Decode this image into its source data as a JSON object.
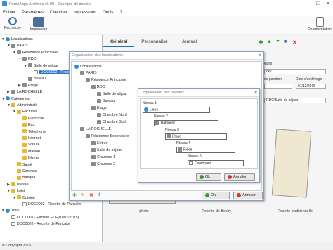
{
  "window": {
    "title": "PersoApps Archives v3.00 - Exemple de dossier",
    "minimize": "–",
    "maximize": "☐",
    "close": "✕"
  },
  "menu": [
    "Fichier",
    "Paramètres",
    "Chercher",
    "Impressions",
    "Outils",
    "?"
  ],
  "toolbar": {
    "search": "Recherche",
    "print": "Impression",
    "docs": "Documentation"
  },
  "tree": [
    {
      "label": "Localisations",
      "d": 0,
      "icon": "globe",
      "ex": "▼"
    },
    {
      "label": "PARIS",
      "d": 1,
      "icon": "house",
      "ex": "▼"
    },
    {
      "label": "Résidence Principale",
      "d": 2,
      "icon": "house",
      "ex": "▼"
    },
    {
      "label": "RDC",
      "d": 3,
      "icon": "house",
      "ex": "▼"
    },
    {
      "label": "Salle de séjour",
      "d": 4,
      "icon": "house",
      "ex": "▼"
    },
    {
      "label": "DOC0002 - Rece",
      "d": 5,
      "icon": "doc",
      "ex": "",
      "sel": true
    },
    {
      "label": "Bureau",
      "d": 4,
      "icon": "house",
      "ex": ""
    },
    {
      "label": "Etage",
      "d": 3,
      "icon": "house",
      "ex": "▶"
    },
    {
      "label": "LA ROCHELLE",
      "d": 1,
      "icon": "house",
      "ex": "▶"
    },
    {
      "label": "Catégories",
      "d": 0,
      "icon": "globe",
      "ex": "▼"
    },
    {
      "label": "Administratif",
      "d": 1,
      "icon": "fold",
      "ex": "▼"
    },
    {
      "label": "Factures",
      "d": 2,
      "icon": "fold",
      "ex": "▼"
    },
    {
      "label": "Électricité",
      "d": 3,
      "icon": "fold",
      "ex": ""
    },
    {
      "label": "Eau",
      "d": 3,
      "icon": "fold",
      "ex": ""
    },
    {
      "label": "Téléphone",
      "d": 3,
      "icon": "fold",
      "ex": ""
    },
    {
      "label": "Internet",
      "d": 3,
      "icon": "fold",
      "ex": ""
    },
    {
      "label": "Voiture",
      "d": 3,
      "icon": "fold",
      "ex": ""
    },
    {
      "label": "Maison",
      "d": 3,
      "icon": "fold",
      "ex": ""
    },
    {
      "label": "Divers",
      "d": 3,
      "icon": "fold",
      "ex": ""
    },
    {
      "label": "Santé",
      "d": 2,
      "icon": "fold",
      "ex": ""
    },
    {
      "label": "Contrats",
      "d": 2,
      "icon": "fold",
      "ex": ""
    },
    {
      "label": "Banque",
      "d": 2,
      "icon": "fold",
      "ex": ""
    },
    {
      "label": "Presse",
      "d": 1,
      "icon": "fold",
      "ex": "▶"
    },
    {
      "label": "Loisir",
      "d": 1,
      "icon": "fold",
      "ex": "▼"
    },
    {
      "label": "Cuisine",
      "d": 2,
      "icon": "fold",
      "ex": "▼"
    },
    {
      "label": "DOC0002 - Recette de Pancake",
      "d": 3,
      "icon": "doc",
      "ex": ""
    },
    {
      "label": "Tous",
      "d": 0,
      "icon": "globe",
      "ex": "▼"
    },
    {
      "label": "DOC0001 - Facture EDF(01/01/2015)",
      "d": 1,
      "icon": "doc",
      "ex": ""
    },
    {
      "label": "DOC0002 - Recette de Pancake",
      "d": 1,
      "icon": "doc",
      "ex": ""
    }
  ],
  "tabs": [
    "Général",
    "Personnalisé",
    "Journal"
  ],
  "fields": {
    "auteurs_label": "eur(s)",
    "auteur_value": "cky",
    "date_label": "de parution",
    "archive_label": "Date d'archivage",
    "archive_value": "01/12/2015",
    "loc_value": "RDC\\Salle de séjour"
  },
  "photos": {
    "captions": [
      "photo",
      "Recette de Becky",
      "Recette traditionnelle"
    ]
  },
  "dlg1": {
    "title": "Organisation des localisations",
    "items": [
      {
        "label": "Localisations",
        "d": 0,
        "icon": "globe"
      },
      {
        "label": "PARIS",
        "d": 1,
        "icon": "house"
      },
      {
        "label": "Résidence Principale",
        "d": 2,
        "icon": "house"
      },
      {
        "label": "RDC",
        "d": 3,
        "icon": "house"
      },
      {
        "label": "Salle de séjour",
        "d": 4,
        "icon": "house"
      },
      {
        "label": "Bureau",
        "d": 4,
        "icon": "house"
      },
      {
        "label": "Etage",
        "d": 3,
        "icon": "house"
      },
      {
        "label": "Chambre Nord",
        "d": 4,
        "icon": "house"
      },
      {
        "label": "Chambre Sud",
        "d": 4,
        "icon": "house"
      },
      {
        "label": "LA ROCHELLE",
        "d": 1,
        "icon": "house"
      },
      {
        "label": "Résidence Secondaire",
        "d": 2,
        "icon": "house"
      },
      {
        "label": "Entrée",
        "d": 3,
        "icon": "house"
      },
      {
        "label": "Salle de séjour",
        "d": 3,
        "icon": "house"
      },
      {
        "label": "Chambre 1",
        "d": 3,
        "icon": "house"
      },
      {
        "label": "Chambre 2",
        "d": 3,
        "icon": "house"
      }
    ],
    "ok": "Ok",
    "cancel": "Annuler"
  },
  "dlg2": {
    "title": "Organisation des niveaux",
    "levels": [
      {
        "n": "Niveau 1",
        "v": "Lieux",
        "icon": "globe"
      },
      {
        "n": "Niveau 2",
        "v": "Bâtiment",
        "icon": "house"
      },
      {
        "n": "Niveau 3",
        "v": "Etage",
        "icon": "house"
      },
      {
        "n": "Niveau 4",
        "v": "Pièce",
        "icon": "house"
      },
      {
        "n": "Niveau 5",
        "v": "Contenant",
        "icon": "doc"
      }
    ],
    "ok": "Ok",
    "cancel": "Annuler"
  },
  "status": "© Copyright 2015"
}
